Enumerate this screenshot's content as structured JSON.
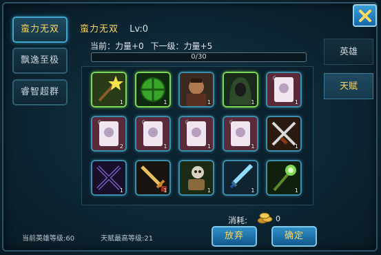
{
  "nav": {
    "items": [
      {
        "label": "蛮力无双",
        "active": true
      },
      {
        "label": "飘逸至极",
        "active": false
      },
      {
        "label": "睿智超群",
        "active": false
      }
    ]
  },
  "tabs": [
    {
      "label": "英雄",
      "active": false
    },
    {
      "label": "天赋",
      "active": true
    }
  ],
  "talent": {
    "name": "蛮力无双",
    "level": "Lv:0",
    "current": "当前：力量+0",
    "next": "下一级：力量+5",
    "progress_text": "0/30",
    "progress_fraction": 0.0
  },
  "grid": [
    {
      "icon": "staff-star-icon",
      "count": "1",
      "highlight": "green"
    },
    {
      "icon": "green-orb-icon",
      "count": "1",
      "highlight": "green"
    },
    {
      "icon": "warrior-portrait-icon",
      "count": "1",
      "highlight": "blue"
    },
    {
      "icon": "hooded-figure-icon",
      "count": "1",
      "highlight": "green"
    },
    {
      "icon": "scroll-icon",
      "count": "1",
      "highlight": "blue"
    },
    {
      "icon": "scroll-icon",
      "count": "2",
      "highlight": "blue"
    },
    {
      "icon": "scroll-icon",
      "count": "1",
      "highlight": "blue"
    },
    {
      "icon": "scroll-icon",
      "count": "1",
      "highlight": "blue"
    },
    {
      "icon": "scroll-icon",
      "count": "1",
      "highlight": "blue"
    },
    {
      "icon": "crossed-swords-icon",
      "count": "1",
      "highlight": "blue"
    },
    {
      "icon": "crossed-swords-purple-icon",
      "count": "1",
      "highlight": "blue"
    },
    {
      "icon": "golden-sword-icon",
      "count": "1",
      "highlight": "blue"
    },
    {
      "icon": "skull-gauntlet-icon",
      "count": "1",
      "highlight": "blue"
    },
    {
      "icon": "ice-sword-icon",
      "count": "1",
      "highlight": "blue"
    },
    {
      "icon": "green-staff-icon",
      "count": "1",
      "highlight": "blue"
    }
  ],
  "cost": {
    "label": "消耗:",
    "value": "0",
    "icon": "gold-coins-icon"
  },
  "footer": {
    "hero_level": "当前英雄等级:60",
    "max_talent_level": "天赋最高等级:21"
  },
  "buttons": {
    "discard": "放弃",
    "confirm": "确定"
  },
  "colors": {
    "accent": "#ffd860",
    "frame": "#2b5466",
    "button": "#1f78b4"
  }
}
